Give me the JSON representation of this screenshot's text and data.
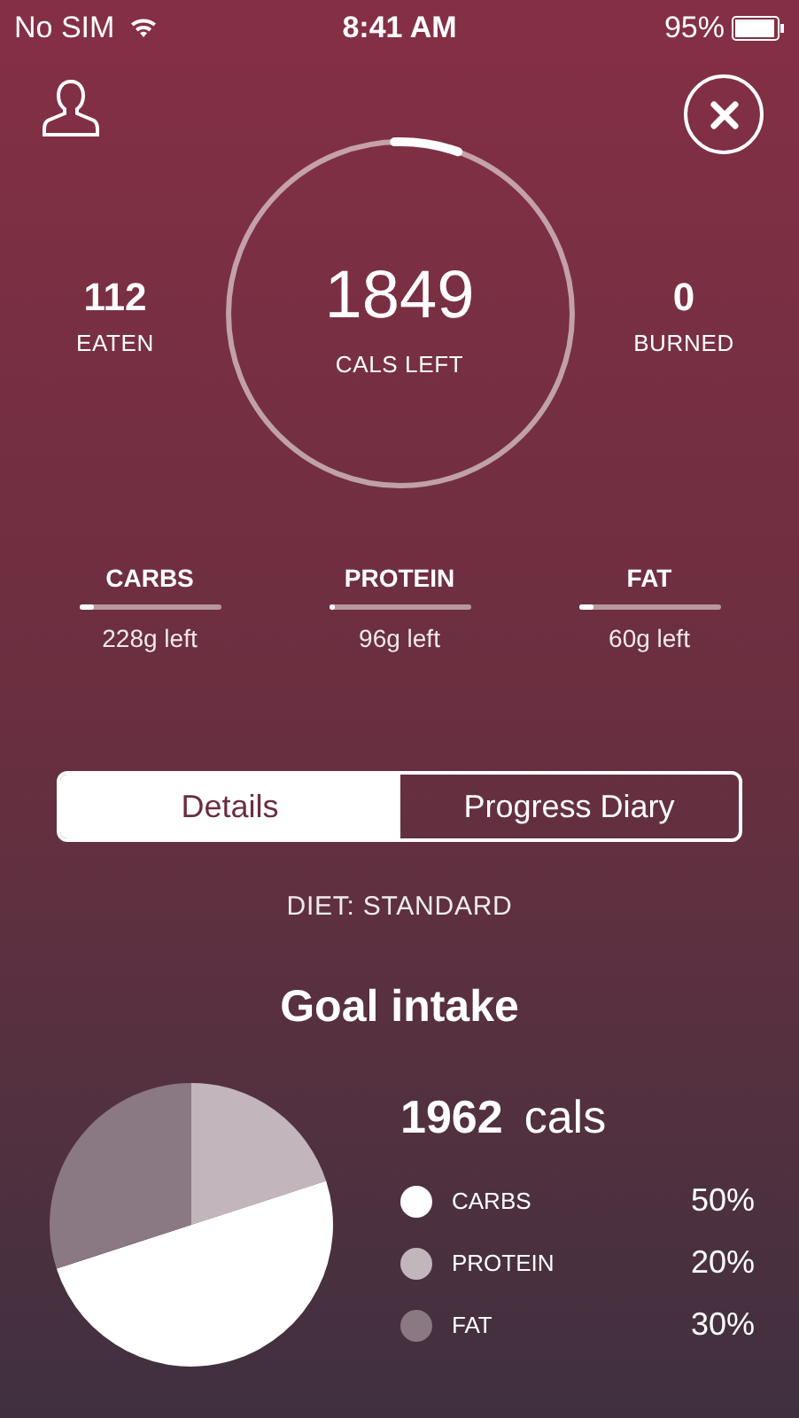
{
  "status_bar": {
    "carrier": "No SIM",
    "time": "8:41 AM",
    "battery": "95%"
  },
  "summary": {
    "eaten": {
      "value": "112",
      "label": "EATEN"
    },
    "remaining": {
      "value": "1849",
      "label": "CALS LEFT",
      "level": 0.06
    },
    "burned": {
      "value": "0",
      "label": "BURNED"
    }
  },
  "macros": [
    {
      "name": "CARBS",
      "left": "228g left",
      "level": 0.1
    },
    {
      "name": "PROTEIN",
      "left": "96g left",
      "level": 0.04
    },
    {
      "name": "FAT",
      "left": "60g left",
      "level": 0.1
    }
  ],
  "tabs": [
    {
      "label": "Details",
      "selected": true
    },
    {
      "label": "Progress Diary",
      "selected": false
    }
  ],
  "diet": "DIET: STANDARD",
  "goal": {
    "title": "Goal intake",
    "calories": "1962",
    "unit": "cals",
    "legend": [
      {
        "label": "CARBS",
        "value": "50%",
        "color": "#ffffff"
      },
      {
        "label": "PROTEIN",
        "value": "20%",
        "color": "#c2b6bc"
      },
      {
        "label": "FAT",
        "value": "30%",
        "color": "#8a7882"
      }
    ],
    "chart_data": {
      "type": "pie",
      "values": [
        20,
        50,
        30
      ]
    }
  }
}
